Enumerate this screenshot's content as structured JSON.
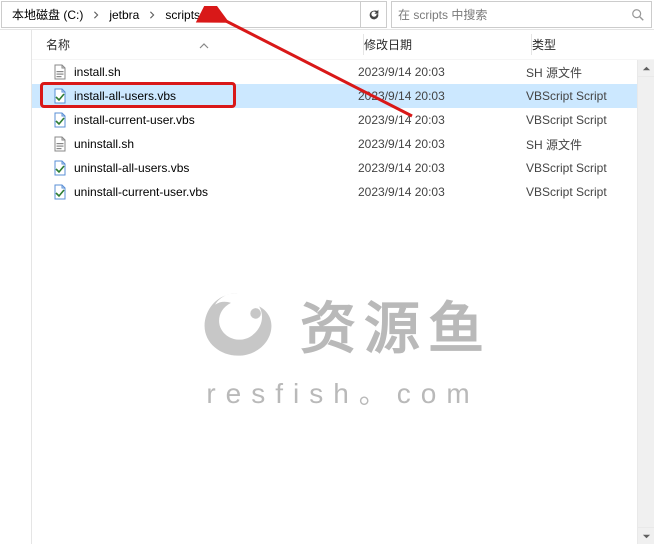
{
  "breadcrumbs": {
    "items": [
      {
        "label": "本地磁盘 (C:)"
      },
      {
        "label": "jetbra"
      },
      {
        "label": "scripts"
      }
    ]
  },
  "search": {
    "placeholder": "在 scripts 中搜索"
  },
  "columns": {
    "name": "名称",
    "date": "修改日期",
    "type": "类型"
  },
  "files": [
    {
      "name": "install.sh",
      "date": "2023/9/14 20:03",
      "type": "SH 源文件",
      "icon": "sh",
      "selected": false
    },
    {
      "name": "install-all-users.vbs",
      "date": "2023/9/14 20:03",
      "type": "VBScript Script",
      "icon": "vbs",
      "selected": true
    },
    {
      "name": "install-current-user.vbs",
      "date": "2023/9/14 20:03",
      "type": "VBScript Script",
      "icon": "vbs",
      "selected": false
    },
    {
      "name": "uninstall.sh",
      "date": "2023/9/14 20:03",
      "type": "SH 源文件",
      "icon": "sh",
      "selected": false
    },
    {
      "name": "uninstall-all-users.vbs",
      "date": "2023/9/14 20:03",
      "type": "VBScript Script",
      "icon": "vbs",
      "selected": false
    },
    {
      "name": "uninstall-current-user.vbs",
      "date": "2023/9/14 20:03",
      "type": "VBScript Script",
      "icon": "vbs",
      "selected": false
    }
  ],
  "watermark": {
    "cn": "资源鱼",
    "en": "resfish。com"
  },
  "annotation": {
    "highlight_index": 1
  }
}
